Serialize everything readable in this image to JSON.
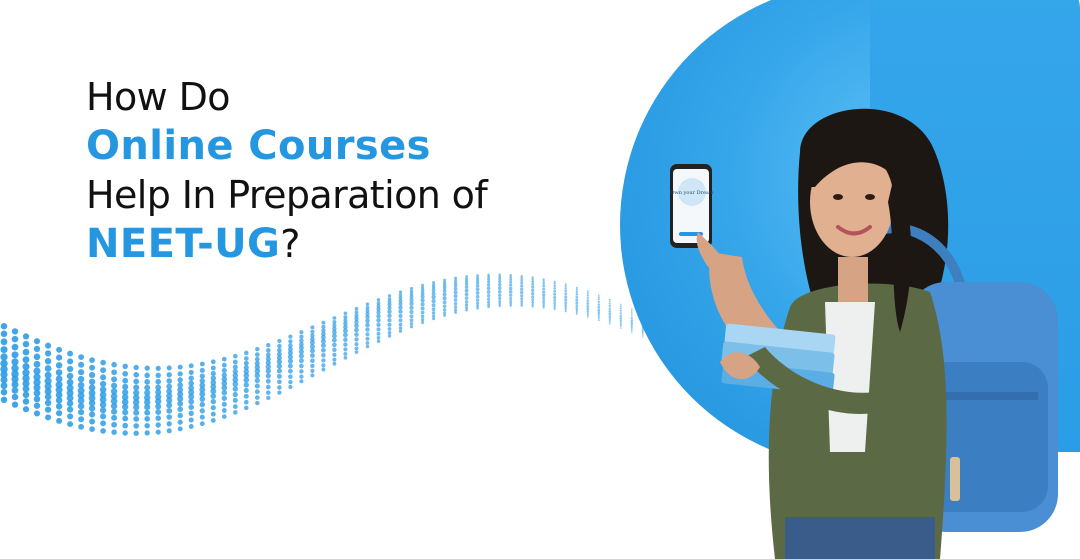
{
  "headline": {
    "line1": "How Do",
    "line2": "Online Courses",
    "line3": "Help In Preparation of",
    "line4": "NEET-UG",
    "line4_suffix": "?"
  },
  "phone": {
    "screen_text": "Own your Dream"
  },
  "colors": {
    "accent_blue": "#2596e0",
    "circle_blue": "#35a6ea",
    "text_dark": "#111111"
  }
}
